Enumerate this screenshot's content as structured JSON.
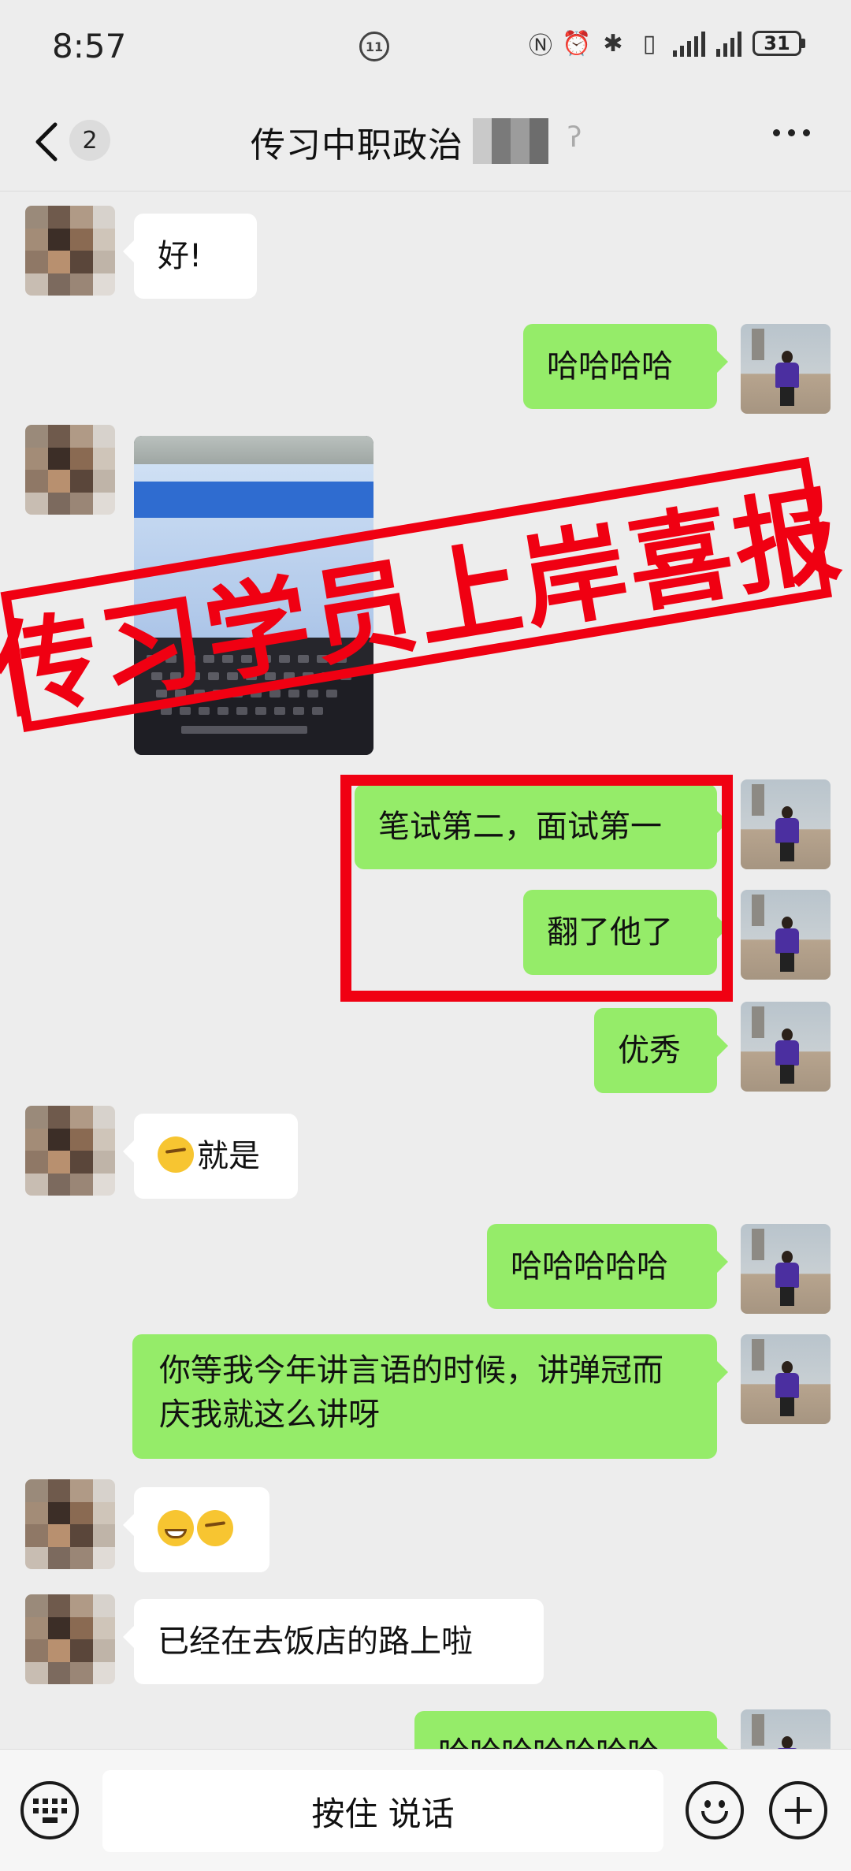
{
  "status_bar": {
    "time": "8:57",
    "battery": "31"
  },
  "header": {
    "unread_count": "2",
    "chat_title": "传习中职政治"
  },
  "messages": [
    {
      "side": "left",
      "text": "好!"
    },
    {
      "side": "right",
      "text": "哈哈哈哈"
    },
    {
      "side": "left",
      "type": "image"
    },
    {
      "side": "right",
      "text": "笔试第二，面试第一"
    },
    {
      "side": "right",
      "text": "翻了他了"
    },
    {
      "side": "right",
      "text": "优秀"
    },
    {
      "side": "left",
      "text": "就是",
      "emoji": "thinking-face"
    },
    {
      "side": "right",
      "text": "哈哈哈哈哈"
    },
    {
      "side": "right",
      "text": "你等我今年讲言语的时候，讲弹冠而庆我就这么讲呀"
    },
    {
      "side": "left",
      "text": "",
      "emoji": "grinning-face thinking-face"
    },
    {
      "side": "left",
      "text": "已经在去饭店的路上啦"
    },
    {
      "side": "right",
      "text": "哈哈哈哈哈哈哈"
    }
  ],
  "overlay": {
    "banner_text": "传习学员上岸喜报"
  },
  "input_bar": {
    "hold_to_talk": "按住 说话"
  },
  "colors": {
    "background": "#ededed",
    "bubble_green": "#95ec69",
    "bubble_white": "#ffffff",
    "banner_red": "#f00012"
  }
}
